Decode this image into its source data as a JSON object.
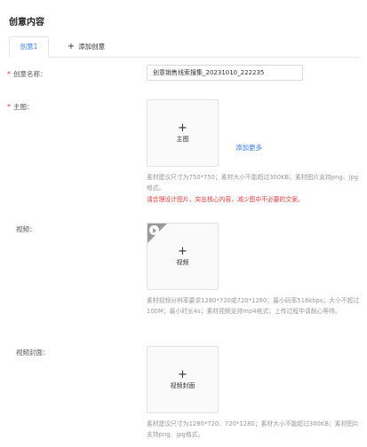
{
  "section": {
    "title": "创意内容"
  },
  "tabs": {
    "active_label": "创意1",
    "add_label": "添加创意",
    "add_symbol": "+"
  },
  "fields": {
    "name": {
      "required_mark": "*",
      "label": "创意名称：",
      "value": "创意销售线索搜集_20231010_222235"
    },
    "main_image": {
      "required_mark": "*",
      "label": "主图：",
      "upload_symbol": "+",
      "upload_text": "主图",
      "add_more": "添加更多",
      "hint": "素材建议尺寸为750*750；素材大小不能超过300KB；素材图片支持png、jpg格式。",
      "warning": "请合理设计图片，突出核心内容，减少图中不必要的文案。"
    },
    "video": {
      "label": "视频：",
      "upload_symbol": "+",
      "upload_text": "视频",
      "hint": "素材视频分辨率要求1280*720或720*1280；最小码率516kbps；大小不超过100M；最小时长4s；素材视频支持mp4格式；上传过程中请耐心等待。"
    },
    "video_cover": {
      "label": "视频封面：",
      "upload_symbol": "+",
      "upload_text": "视频封面",
      "hint": "素材建议尺寸为1280*720、720*1280；素材大小不能超过300KB；素材图片支持png、jpg格式。"
    }
  },
  "colors": {
    "accent": "#3a7de9",
    "required": "#e33333",
    "warning": "#e4393c",
    "hint": "#999999"
  }
}
